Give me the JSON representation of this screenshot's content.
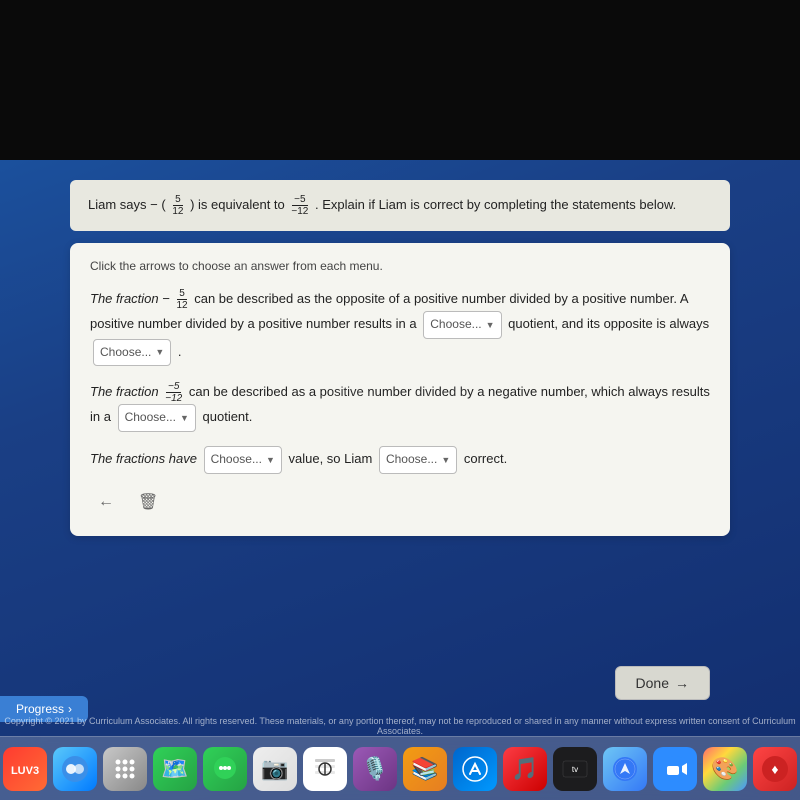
{
  "screen": {
    "top_dark_height": 160
  },
  "question": {
    "text_parts": [
      "Liam says −",
      " is equivalent to ",
      ". Explain if Liam is correct by completing the statements below."
    ],
    "fraction1_num": "5",
    "fraction1_den": "12",
    "fraction2_num": "−5",
    "fraction2_den": "−12"
  },
  "instruction": "Click the arrows to choose an answer from each menu.",
  "paragraphs": {
    "p1_part1": "The fraction −",
    "p1_frac_num": "5",
    "p1_frac_den": "12",
    "p1_part2": " can be described as the opposite of a positive number divided by a positive number. A positive number divided by a positive number results in a",
    "p1_choose1": "Choose...",
    "p1_part3": " quotient, and its opposite is always",
    "p1_choose2": "Choose...",
    "p1_end": ".",
    "p2_part1": "The fraction ",
    "p2_frac_num": "−5",
    "p2_frac_den": "−12",
    "p2_part2": " can be described as a positive number divided by a negative number, which always results in a",
    "p2_choose1": "Choose...",
    "p2_end": " quotient.",
    "p3_part1": "The fractions have",
    "p3_choose1": "Choose...",
    "p3_part2": " value, so Liam",
    "p3_choose2": "Choose...",
    "p3_end": " correct."
  },
  "buttons": {
    "done": "Done",
    "progress": "Progress",
    "done_arrow": "→"
  },
  "footer": "Copyright © 2021 by Curriculum Associates. All rights reserved. These materials, or any portion thereof, may not be reproduced or shared in any manner without express written consent of Curriculum Associates.",
  "dock": {
    "icons": [
      "📅",
      "🔵",
      "🚀",
      "🗺️",
      "💬",
      "📷",
      "🎵",
      "🛍️",
      "📺",
      "🌐",
      "📹",
      "🎨",
      "🔴"
    ]
  }
}
